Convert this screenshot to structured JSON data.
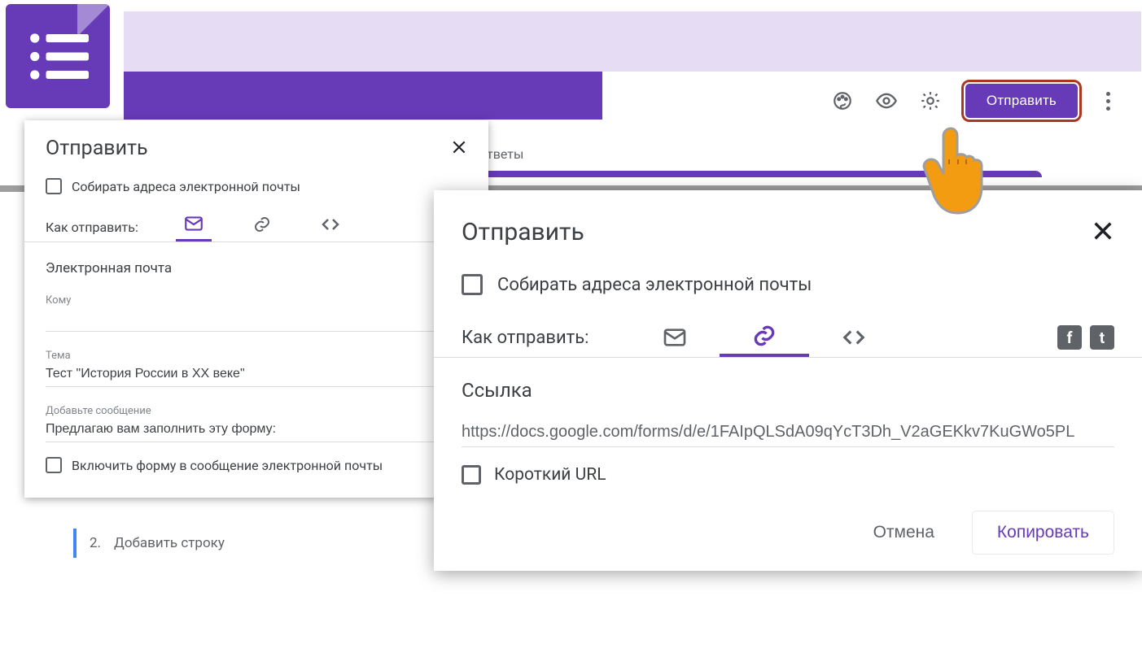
{
  "app": {
    "logo_label": "Google Forms"
  },
  "toolbar": {
    "theme_icon": "palette-icon",
    "preview_icon": "eye-icon",
    "settings_icon": "gear-icon",
    "send_label": "Отправить",
    "more_icon": "more-vert-icon"
  },
  "background": {
    "tab_responses": "тветы"
  },
  "dialog_email": {
    "title": "Отправить",
    "collect_emails": "Собирать адреса электронной почты",
    "sendvia_label": "Как отправить:",
    "section_email": "Электронная почта",
    "to_label": "Кому",
    "to_value": "",
    "subject_label": "Тема",
    "subject_value": "Тест \"История России в XX веке\"",
    "message_label": "Добавьте сообщение",
    "message_value": "Предлагаю вам заполнить эту форму:",
    "include_form": "Включить форму в сообщение электронной почты"
  },
  "addline": {
    "num": "2.",
    "text": "Добавить строку"
  },
  "dialog_link": {
    "title": "Отправить",
    "collect_emails": "Собирать адреса электронной почты",
    "sendvia_label": "Как отправить:",
    "link_section": "Ссылка",
    "link_value": "https://docs.google.com/forms/d/e/1FAIpQLSdA09qYcT3Dh_V2aGEKkv7KuGWo5PL",
    "short_url": "Короткий URL",
    "cancel": "Отмена",
    "copy": "Копировать",
    "fb": "f",
    "tw": "t"
  }
}
